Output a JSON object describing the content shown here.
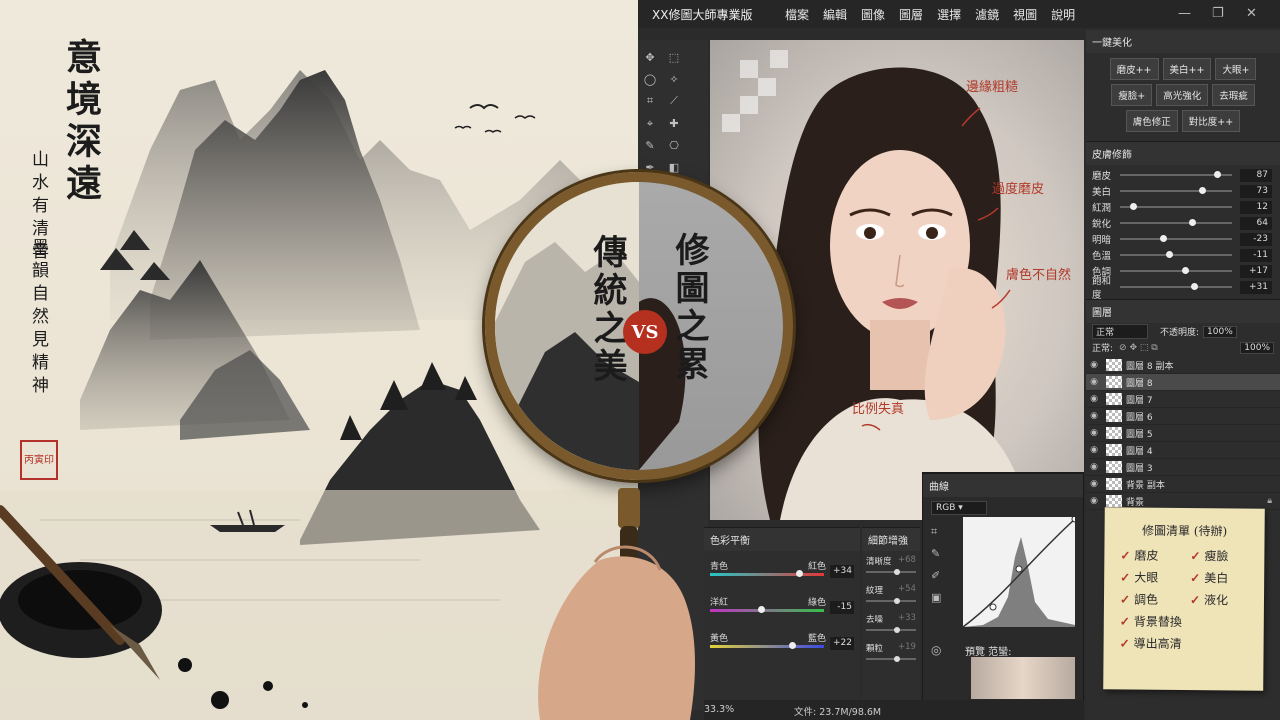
{
  "left": {
    "title": "意境深遠",
    "poem_line1": "山水有清音",
    "poem_line2": "墨韻自然見精神",
    "seal": "丙寅印"
  },
  "magnifier": {
    "left_text": "傳統之美",
    "right_text": "修圖之累",
    "vs": "VS"
  },
  "app": {
    "title": "XX修圖大師專業版",
    "menu": [
      "檔案",
      "編輯",
      "圖像",
      "圖層",
      "選擇",
      "濾鏡",
      "視圖",
      "說明"
    ],
    "window_controls": {
      "minimize": "—",
      "maximize": "❐",
      "close": "✕"
    }
  },
  "annotations": {
    "edge": "邊緣粗糙",
    "smooth": "過度磨皮",
    "skin": "膚色不自然",
    "ratio": "比例失真"
  },
  "beautify": {
    "header": "一鍵美化",
    "buttons": [
      "磨皮++",
      "美白++",
      "大眼+",
      "瘦臉+",
      "高光強化",
      "去瑕疵",
      "膚色修正",
      "對比度++"
    ]
  },
  "skin": {
    "header": "皮膚修飾",
    "sliders": [
      {
        "label": "磨皮",
        "value": "87",
        "pos": 0.87
      },
      {
        "label": "美白",
        "value": "73",
        "pos": 0.73
      },
      {
        "label": "紅潤",
        "value": "12",
        "pos": 0.12
      },
      {
        "label": "銳化",
        "value": "64",
        "pos": 0.64
      },
      {
        "label": "明暗",
        "value": "-23",
        "pos": 0.38
      },
      {
        "label": "色溫",
        "value": "-11",
        "pos": 0.44
      },
      {
        "label": "色調",
        "value": "+17",
        "pos": 0.58
      },
      {
        "label": "飽和度",
        "value": "+31",
        "pos": 0.66
      }
    ]
  },
  "layers": {
    "header": "圖層",
    "blend_mode": "正常",
    "opacity_label": "不透明度:",
    "opacity": "100%",
    "lock_label": "正常:",
    "fill": "100%",
    "items": [
      "圖層 8 副本",
      "圖層 8",
      "圖層 7",
      "圖層 6",
      "圖層 5",
      "圖層 4",
      "圖層 3",
      "背景 副本",
      "背景"
    ],
    "selected_index": 1
  },
  "color_balance": {
    "header": "色彩平衡",
    "rows": [
      {
        "left": "青色",
        "right": "紅色",
        "value": "+34",
        "pos": 0.78
      },
      {
        "left": "洋紅",
        "right": "綠色",
        "value": "-15",
        "pos": 0.45
      },
      {
        "left": "黃色",
        "right": "藍色",
        "value": "+22",
        "pos": 0.72
      }
    ]
  },
  "detail": {
    "header": "細節增強",
    "rows": [
      {
        "label": "清晰度",
        "value": "+68"
      },
      {
        "label": "紋理",
        "value": "+54"
      },
      {
        "label": "去噪",
        "value": "+33"
      },
      {
        "label": "顆粒",
        "value": "+19"
      }
    ]
  },
  "curves": {
    "header": "曲線",
    "channel": "RGB",
    "preview_label": "預覽 范蠻:"
  },
  "status": {
    "zoom": "33.3%",
    "file": "文件: 23.7M/98.6M"
  },
  "checklist": {
    "title": "修圖清單 (待辦)",
    "items": [
      "磨皮",
      "瘦臉",
      "大眼",
      "美白",
      "調色",
      "液化",
      "背景替換",
      "導出高清"
    ]
  }
}
